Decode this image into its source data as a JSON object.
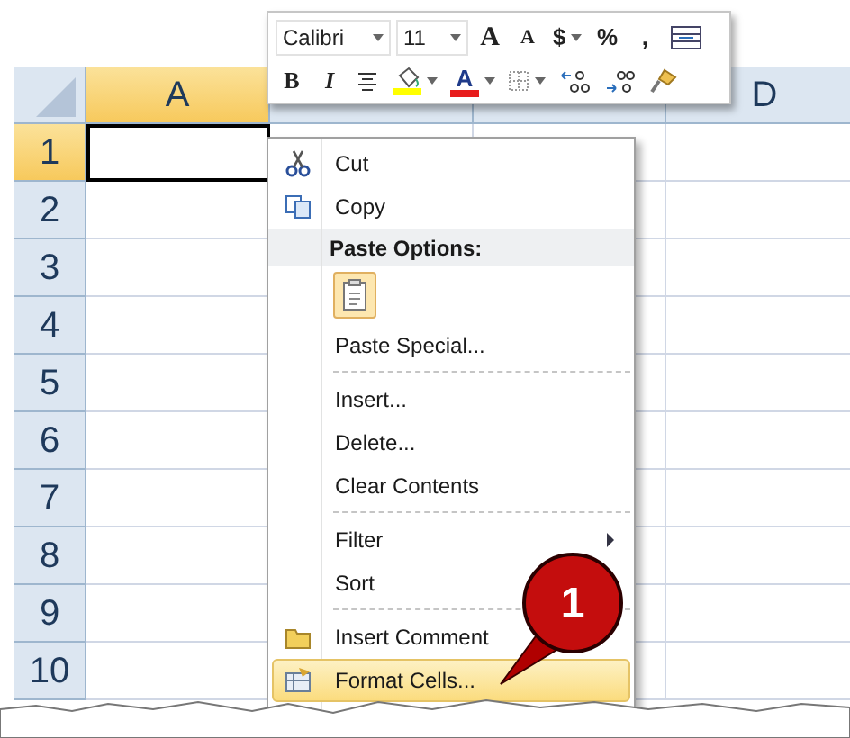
{
  "sheet": {
    "columns": [
      {
        "label": "A",
        "selected": true
      },
      {},
      {},
      {
        "label": "D",
        "selected": false
      }
    ],
    "rows": [
      {
        "label": "1",
        "selected": true
      },
      {
        "label": "2",
        "selected": false
      },
      {
        "label": "3",
        "selected": false
      },
      {
        "label": "4",
        "selected": false
      },
      {
        "label": "5",
        "selected": false
      },
      {
        "label": "6",
        "selected": false
      },
      {
        "label": "7",
        "selected": false
      },
      {
        "label": "8",
        "selected": false
      },
      {
        "label": "9",
        "selected": false
      },
      {
        "label": "10",
        "selected": false
      }
    ]
  },
  "mini_toolbar": {
    "font_name": "Calibri",
    "font_size": "11",
    "row_1": [
      {
        "kind": "grow-font",
        "label": "A"
      },
      {
        "kind": "shrink-font",
        "label": "A"
      },
      {
        "kind": "currency",
        "label": "$",
        "has_dropdown": true
      },
      {
        "kind": "percent",
        "label": "%"
      },
      {
        "kind": "comma",
        "label": ","
      },
      {
        "kind": "merge"
      }
    ],
    "row_2": [
      {
        "kind": "bold",
        "label": "B"
      },
      {
        "kind": "italic",
        "label": "I"
      },
      {
        "kind": "center"
      },
      {
        "kind": "fill",
        "has_dropdown": true,
        "color": "#ffff00"
      },
      {
        "kind": "font-color",
        "label": "A",
        "has_dropdown": true,
        "color": "#e81c1c"
      },
      {
        "kind": "borders",
        "has_dropdown": true
      },
      {
        "kind": "increase-decimal"
      },
      {
        "kind": "decrease-decimal"
      },
      {
        "kind": "painter"
      }
    ]
  },
  "context_menu": [
    {
      "kind": "cut",
      "label": "Cut",
      "selected": false
    },
    {
      "kind": "copy",
      "label": "Copy",
      "selected": false
    },
    {
      "kind": "header",
      "label": "Paste Options:"
    },
    {
      "kind": "paste-button"
    },
    {
      "kind": "plain",
      "label": "Paste Special...",
      "selected": false
    },
    {
      "kind": "separator"
    },
    {
      "kind": "plain",
      "label": "Insert...",
      "selected": false
    },
    {
      "kind": "plain",
      "label": "Delete...",
      "selected": false
    },
    {
      "kind": "plain",
      "label": "Clear Contents",
      "selected": false
    },
    {
      "kind": "separator"
    },
    {
      "kind": "plain",
      "label": "Filter",
      "selected": false,
      "has_submenu": true
    },
    {
      "kind": "plain",
      "label": "Sort",
      "selected": false
    },
    {
      "kind": "separator"
    },
    {
      "kind": "comment",
      "label": "Insert Comment",
      "selected": false
    },
    {
      "kind": "format",
      "label": "Format Cells...",
      "selected": true
    }
  ],
  "callout": {
    "label": "1"
  }
}
